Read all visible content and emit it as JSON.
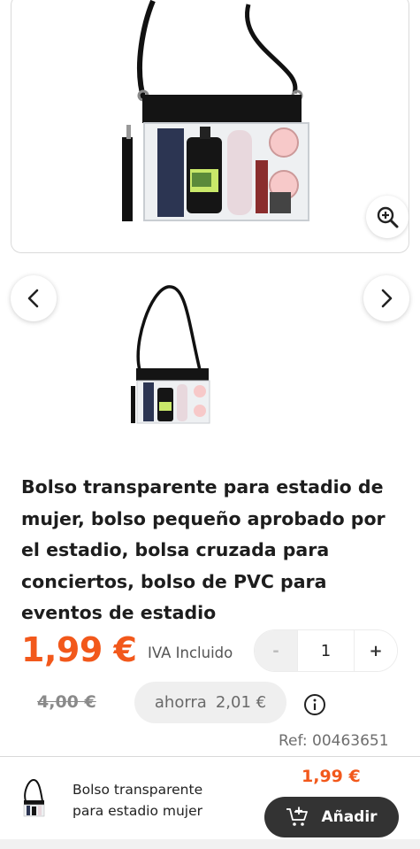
{
  "product": {
    "title": "Bolso transparente para estadio de mujer, bolso pequeño aprobado por el estadio, bolsa cruzada para conciertos, bolso de PVC para eventos de estadio",
    "price": "1,99 €",
    "vat_label": "IVA Incluido",
    "old_price": "4,00 €",
    "savings_label": "ahorra",
    "savings_amount": "2,01 €",
    "ref": "Ref: 00463651"
  },
  "quantity": {
    "minus_label": "-",
    "value": "1",
    "plus_label": "+"
  },
  "gallery": {
    "zoom_icon": "zoom-in-icon",
    "prev_icon": "chevron-left-icon",
    "next_icon": "chevron-right-icon"
  },
  "footer": {
    "name": "Bolso transparente para estadio mujer",
    "price": "1,99 €",
    "add_label": "Añadir",
    "cart_icon": "cart-add-icon"
  },
  "colors": {
    "accent": "#f2581b",
    "button_dark": "#333333"
  }
}
